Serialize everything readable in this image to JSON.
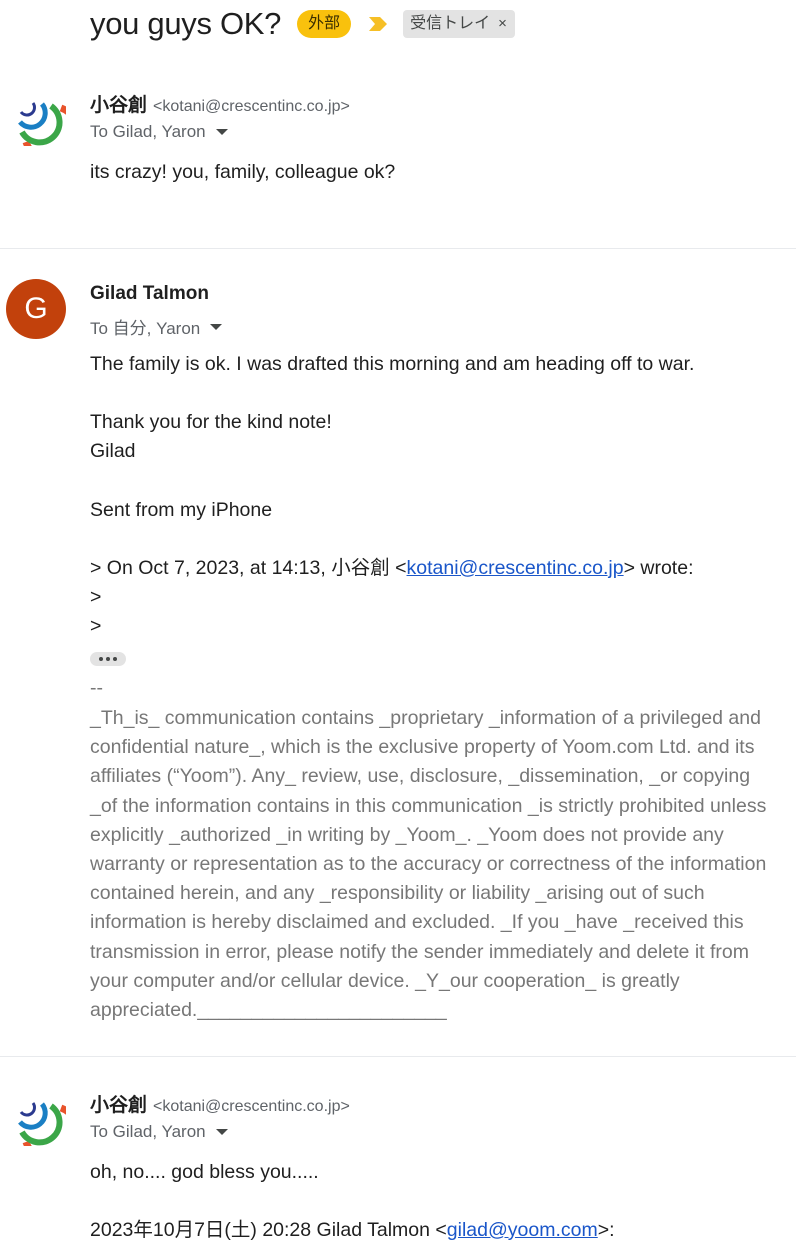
{
  "thread": {
    "subject": "you guys OK?",
    "tag_external": "外部",
    "tag_inbox": "受信トレイ",
    "tag_inbox_close": "×"
  },
  "messages": [
    {
      "sender_name": "小谷創",
      "sender_email": "<kotani@crescentinc.co.jp>",
      "to": "To Gilad, Yaron",
      "body": "its crazy! you, family, colleague ok?"
    },
    {
      "avatar_letter": "G",
      "avatar_color": "#c2410c",
      "sender_name": "Gilad Talmon",
      "to": "To 自分, Yaron",
      "body_lines": [
        "The family is ok. I was drafted this morning and am heading off to war.",
        "",
        "Thank you for the kind note!",
        "Gilad",
        "",
        "Sent from my iPhone",
        ""
      ],
      "quote_prefix": "> On Oct 7, 2023, at 14:13, 小谷創 <",
      "quote_link": "kotani@crescentinc.co.jp",
      "quote_suffix": "> wrote:",
      "quote_lines": [
        ">",
        ">"
      ],
      "signature_dash": "--",
      "signature": "_Th_is_ communication contains _proprietary _information of a privileged and confidential nature_, which is the exclusive property of Yoom.com Ltd. and its affiliates (“Yoom”). Any_ review, use, disclosure, _dissemination, _or copying _of the information contains in this communication _is strictly prohibited unless explicitly _authorized _in writing by _Yoom_. _Yoom does not provide any warranty or representation as to the accuracy or correctness of the information contained herein, and any _responsibility or liability _arising out of such information is hereby disclaimed and excluded. _If you _have _received this transmission in error, please notify the sender immediately and delete it from your computer and/or cellular device. _Y_our cooperation_ is greatly appreciated._______________________"
    },
    {
      "sender_name": "小谷創",
      "sender_email": "<kotani@crescentinc.co.jp>",
      "to": "To Gilad, Yaron",
      "body": "oh, no.... god bless you.....",
      "quote_prefix": "2023年10月7日(土) 20:28 Gilad Talmon <",
      "quote_link": "gilad@yoom.com",
      "quote_suffix": ">:"
    }
  ],
  "colors": {
    "external_tag": "#f9c10d",
    "importance_marker": "#f6bf26",
    "link": "#1a56c9"
  }
}
